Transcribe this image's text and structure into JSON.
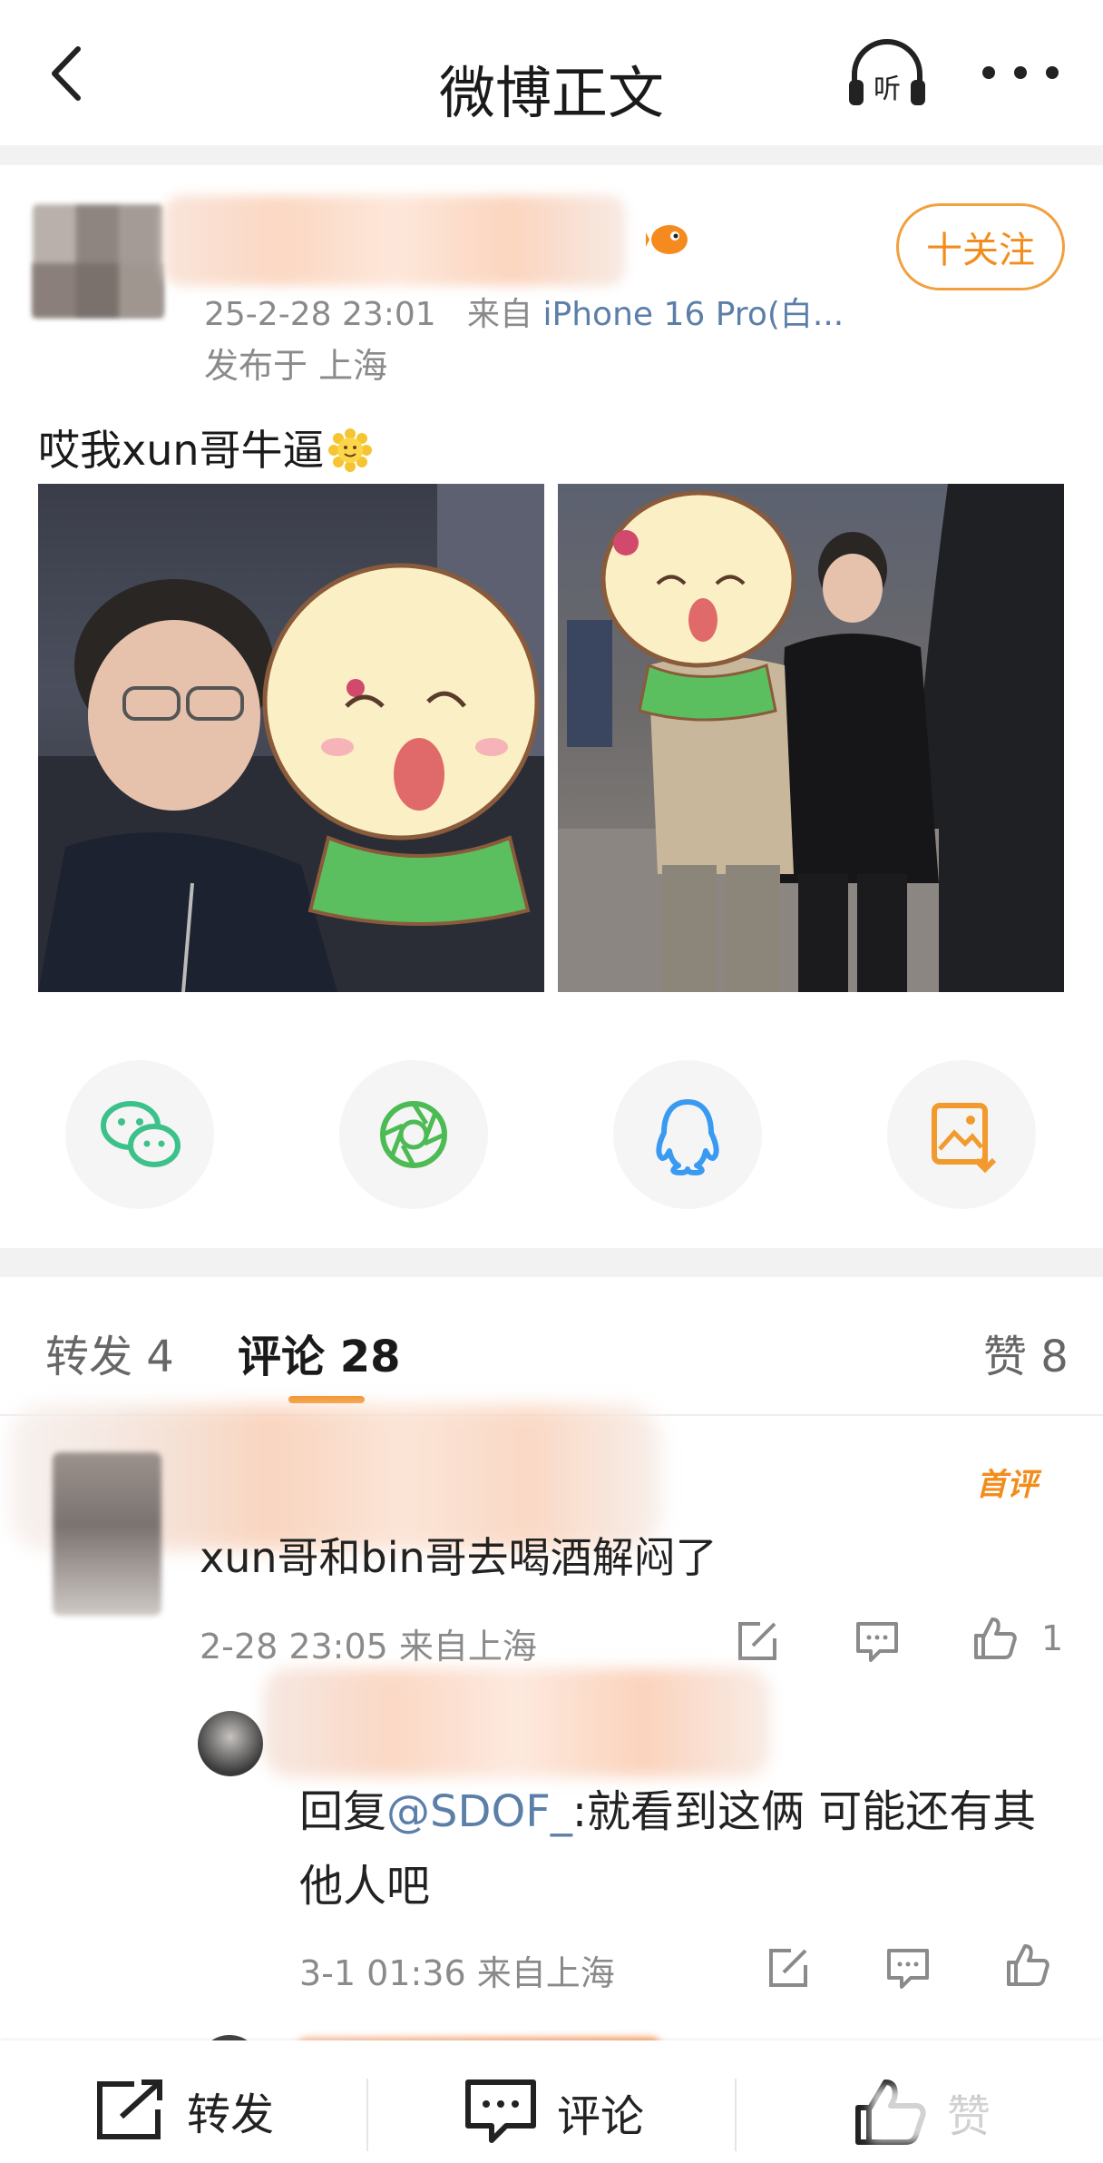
{
  "header": {
    "title": "微博正文",
    "listen_label": "听"
  },
  "post": {
    "follow_label": "十关注",
    "time": "25-2-28 23:01",
    "source_prefix": "来自",
    "source": "iPhone 16 Pro(白...",
    "location": "发布于 上海",
    "text": "哎我xun哥牛逼"
  },
  "share_icons": [
    "wechat-icon",
    "moments-icon",
    "qq-icon",
    "save-image-icon"
  ],
  "colors": {
    "accent": "#f28d1d",
    "link": "#5b7fa8",
    "wechat": "#3cc18a",
    "moments": "#4dbb54",
    "qq": "#3a9af2",
    "save": "#f29a2e"
  },
  "tabs": {
    "repost": "转发 4",
    "comment": "评论 28",
    "like": "赞 8"
  },
  "comment": {
    "badge": "首评",
    "text": "xun哥和bin哥去喝酒解闷了",
    "meta": "2-28 23:05  来自上海",
    "like_count": "1"
  },
  "reply": {
    "prefix": "回复",
    "mention": "@SDOF_",
    "text": ":就看到这俩 可能还有其他人吧",
    "meta": "3-1 01:36  来自上海"
  },
  "bottom_bar": {
    "repost": "转发",
    "comment": "评论",
    "like": "赞"
  }
}
